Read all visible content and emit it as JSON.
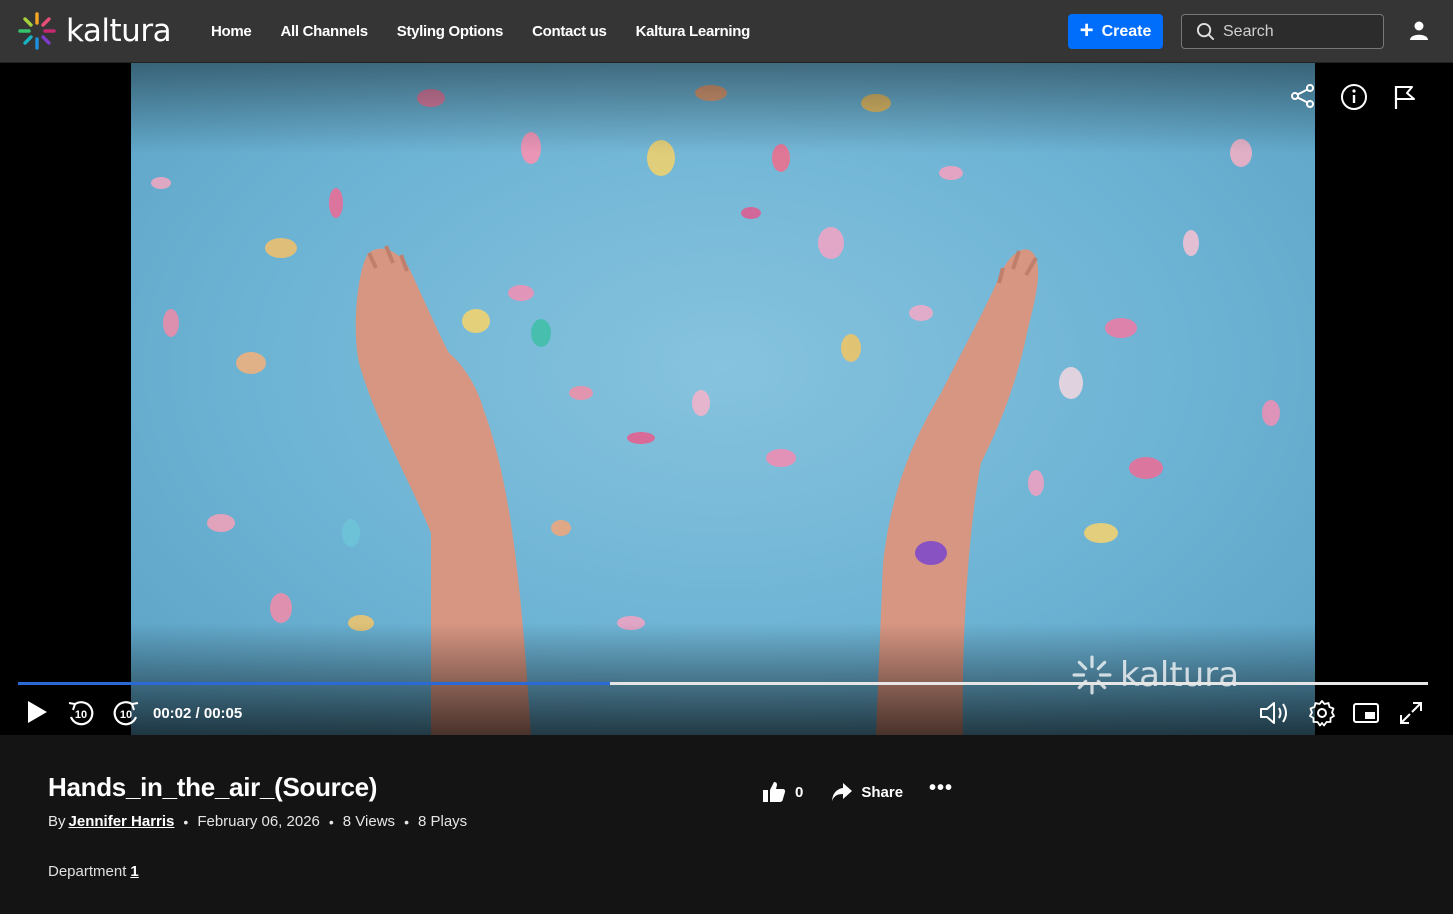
{
  "header": {
    "logo_text": "kaltura",
    "nav": [
      "Home",
      "All Channels",
      "Styling Options",
      "Contact us",
      "Kaltura Learning"
    ],
    "create_label": "Create",
    "search_placeholder": "Search"
  },
  "player": {
    "current_time": "00:02",
    "duration": "00:05",
    "time_display": "00:02 / 00:05",
    "progress_fraction": 0.42,
    "skip_back_seconds": "10",
    "skip_forward_seconds": "10",
    "watermark_text": "kaltura"
  },
  "entry": {
    "title": "Hands_in_the_air_(Source)",
    "by_label": "By",
    "author": "Jennifer Harris",
    "date": "February 06, 2026",
    "views": "8 Views",
    "plays": "8 Plays",
    "likes": "0",
    "share_label": "Share",
    "more_label": "•••",
    "department_label": "Department",
    "department_value": "1"
  },
  "colors": {
    "accent": "#006efa",
    "progress": "#2a69d6",
    "header_bg": "#353535",
    "page_bg": "#141414",
    "video_bg": "#6db3d4"
  }
}
